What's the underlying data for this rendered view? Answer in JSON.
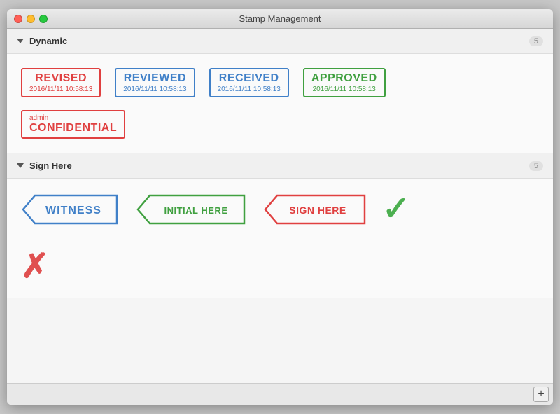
{
  "window": {
    "title": "Stamp Management"
  },
  "dynamic_section": {
    "label": "Dynamic",
    "count": "5",
    "stamps": [
      {
        "id": "revised",
        "label": "REVISED",
        "date": "2016/11/11 10:58:13",
        "color": "red"
      },
      {
        "id": "reviewed",
        "label": "REVIEWED",
        "date": "2016/11/11 10:58:13",
        "color": "blue"
      },
      {
        "id": "received",
        "label": "RECEIVED",
        "date": "2016/11/11 10:58:13",
        "color": "blue"
      },
      {
        "id": "approved",
        "label": "APPROVED",
        "date": "2016/11/11 10:58:13",
        "color": "green"
      }
    ],
    "confidential": {
      "admin_label": "admin",
      "label": "CONFIDENTIAL",
      "color": "red"
    }
  },
  "sign_here_section": {
    "label": "Sign Here",
    "count": "5",
    "stamps": [
      {
        "id": "witness",
        "label": "WITNESS",
        "color": "blue"
      },
      {
        "id": "initial-here",
        "label": "INITIAL HERE",
        "color": "green"
      },
      {
        "id": "sign-here",
        "label": "SIGN HERE",
        "color": "red"
      }
    ],
    "checkmark": "✓",
    "cross": "✗"
  },
  "toolbar": {
    "add_label": "+"
  }
}
